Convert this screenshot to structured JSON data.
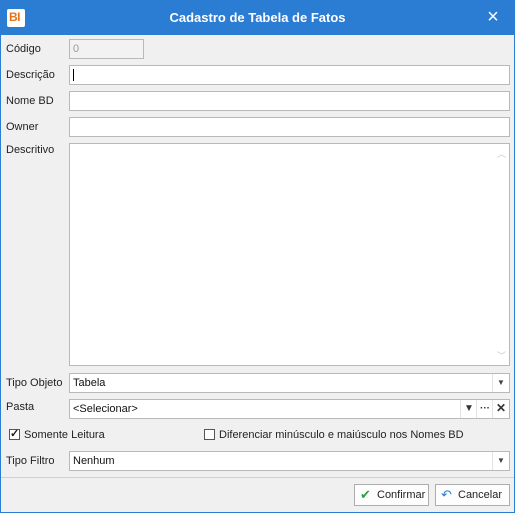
{
  "window": {
    "logo": "BI",
    "title": "Cadastro de Tabela de Fatos",
    "close_icon": "×"
  },
  "form": {
    "codigo": {
      "label": "Código",
      "value": "0"
    },
    "descricao": {
      "label": "Descrição",
      "value": ""
    },
    "nome_bd": {
      "label": "Nome BD",
      "value": ""
    },
    "owner": {
      "label": "Owner",
      "value": ""
    },
    "descritivo": {
      "label": "Descritivo",
      "value": ""
    },
    "tipo_objeto": {
      "label": "Tipo Objeto",
      "value": "Tabela"
    },
    "pasta": {
      "label": "Pasta",
      "value": "<Selecionar>"
    },
    "somente_leitura": {
      "label": "Somente Leitura",
      "checked": true
    },
    "diferenciar": {
      "label": "Diferenciar minúsculo e maiúsculo nos Nomes BD",
      "checked": false
    },
    "tipo_filtro": {
      "label": "Tipo Filtro",
      "value": "Nenhum"
    }
  },
  "footer": {
    "confirm_label": "Confirmar",
    "cancel_label": "Cancelar"
  },
  "colors": {
    "titlebar": "#2b7cd3",
    "logo_text": "#e8731a",
    "confirm_icon": "#2f9e3f",
    "cancel_icon": "#2b7cd3"
  }
}
